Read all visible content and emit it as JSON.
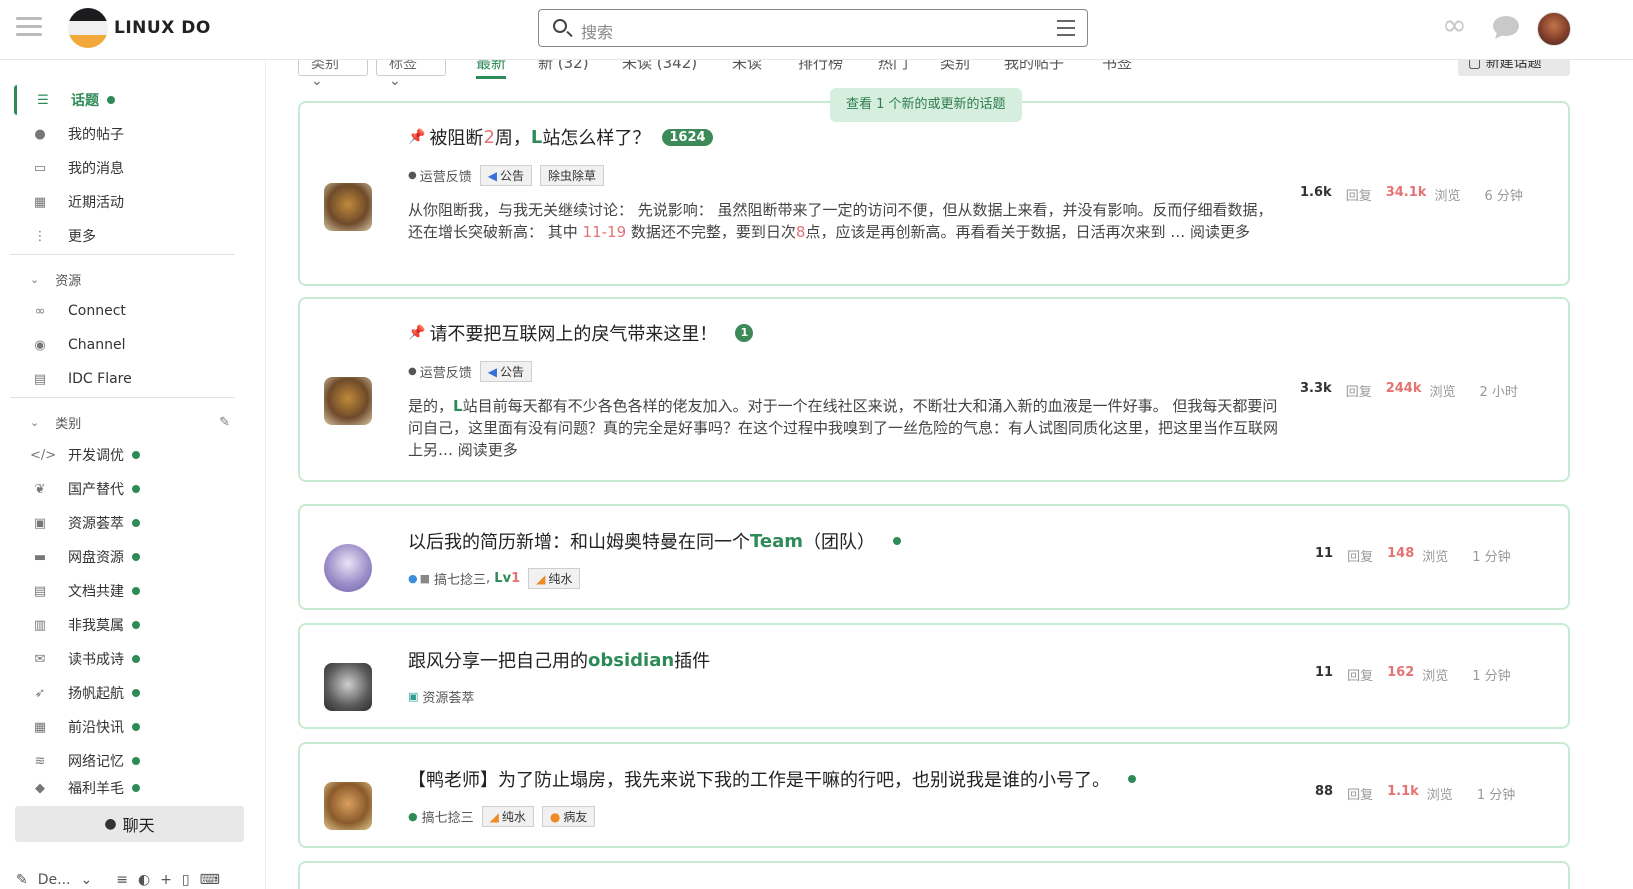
{
  "header": {
    "site_name": "LINUX DO",
    "search_placeholder": "搜索"
  },
  "sidebar": {
    "items": [
      {
        "label": "话题",
        "icon": "layers-icon"
      },
      {
        "label": "我的帖子",
        "icon": "user-icon"
      },
      {
        "label": "我的消息",
        "icon": "inbox-icon"
      },
      {
        "label": "近期活动",
        "icon": "calendar-icon"
      },
      {
        "label": "更多",
        "icon": "more-icon"
      }
    ],
    "resources_header": "资源",
    "resources": [
      {
        "label": "Connect"
      },
      {
        "label": "Channel"
      },
      {
        "label": "IDC Flare"
      }
    ],
    "categories_header": "类别",
    "categories": [
      {
        "label": "开发调优",
        "icon": "</>"
      },
      {
        "label": "国产替代",
        "icon": "❦"
      },
      {
        "label": "资源荟萃",
        "icon": "▣"
      },
      {
        "label": "网盘资源",
        "icon": "▬"
      },
      {
        "label": "文档共建",
        "icon": "▤"
      },
      {
        "label": "非我莫属",
        "icon": "▥"
      },
      {
        "label": "读书成诗",
        "icon": "✉"
      },
      {
        "label": "扬帆起航",
        "icon": "➶"
      },
      {
        "label": "前沿快讯",
        "icon": "▦"
      },
      {
        "label": "网络记忆",
        "icon": "≋"
      },
      {
        "label": "福利羊毛",
        "icon": "◆"
      }
    ],
    "chat_label": "聊天",
    "bottom_label": "De..."
  },
  "navbar": {
    "dropdowns": [
      "类别",
      "标签"
    ],
    "tabs": [
      "最新",
      "新 (32)",
      "未读 (342)",
      "未读",
      "排行榜",
      "热门",
      "类别",
      "我的帖子",
      "书签"
    ],
    "new_topic": "新建话题"
  },
  "new_banner": "查看 1 个新的或更新的话题",
  "topics": [
    {
      "title_pre": "被阻断",
      "title_hl": "2",
      "title_mid": "周，",
      "title_g": "L",
      "title_post": "站怎么样了？",
      "count_badge": "1624",
      "category": "运营反馈",
      "tags": [
        "公告",
        "除虫除草"
      ],
      "excerpt_a": "从你阻断我，与我无关继续讨论： 先说影响： 虽然阻断带来了一定的访问不便，但从数据上来看，并没有影响。反而仔细看数据，还在增长突破新高： 其中 ",
      "excerpt_num1": "11-19",
      "excerpt_b": " 数据还不完整，要到日次",
      "excerpt_num2": "8",
      "excerpt_c": "点，应该是再创新高。再看看关于数据，日活再次来到 … 阅读更多",
      "replies": "1.6k",
      "replies_label": "回复",
      "views": "34.1k",
      "views_label": "浏览",
      "time": "6 分钟"
    },
    {
      "title_pre": "请不要把互联网上的戾气带来这里！",
      "count_badge": "1",
      "category": "运营反馈",
      "tags": [
        "公告"
      ],
      "excerpt_a": "是的，",
      "excerpt_g": "L",
      "excerpt_b": "站目前每天都有不少各色各样的佬友加入。对于一个在线社区来说，不断壮大和涌入新的血液是一件好事。 但我每天都要问问自己，这里面有没有问题？真的完全是好事吗？在这个过程中我嗅到了一丝危险的气息：有人试图同质化这里，把这里当作互联网上另… 阅读更多",
      "replies": "3.3k",
      "replies_label": "回复",
      "views": "244k",
      "views_label": "浏览",
      "time": "2 小时"
    },
    {
      "title_pre": "以后我的简历新增：和山姆奥特曼在同一个",
      "title_g": "Team",
      "title_post": " （团队）",
      "category": "搞七捻三",
      "level_pre": "Lv",
      "level_num": "1",
      "tags": [
        "纯水"
      ],
      "replies": "11",
      "replies_label": "回复",
      "views": "148",
      "views_label": "浏览",
      "time": "1 分钟"
    },
    {
      "title_pre": "跟风分享一把自己用的",
      "title_g": "obsidian",
      "title_post": "插件",
      "category": "资源荟萃",
      "replies": "11",
      "replies_label": "回复",
      "views": "162",
      "views_label": "浏览",
      "time": "1 分钟"
    },
    {
      "title_pre": "【鸭老师】为了防止塌房，我先来说下我的工作是干嘛的行吧，也别说我是谁的小号了。",
      "category": "搞七捻三",
      "tags": [
        "纯水",
        "病友"
      ],
      "replies": "88",
      "replies_label": "回复",
      "views": "1.1k",
      "views_label": "浏览",
      "time": "1 分钟"
    }
  ],
  "colors": {
    "accent": "#2e8b57",
    "highlight": "#e57373",
    "card_border": "#c6ead2",
    "banner_bg": "#d6eedd"
  }
}
